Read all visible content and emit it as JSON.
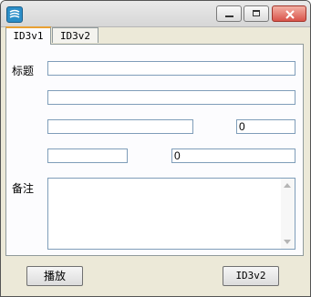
{
  "window": {
    "title": "",
    "icon": "app-logo-icon"
  },
  "tabs": [
    {
      "label": "ID3v1",
      "selected": true
    },
    {
      "label": "ID3v2",
      "selected": false
    }
  ],
  "form": {
    "title_label": "标题",
    "comment_label": "备注",
    "title_value": "",
    "artist_value": "",
    "album_value": "",
    "year_value": "0",
    "genre_value": "",
    "track_value": "0",
    "comment_value": ""
  },
  "buttons": {
    "play": "播放",
    "id3v2": "ID3v2"
  }
}
